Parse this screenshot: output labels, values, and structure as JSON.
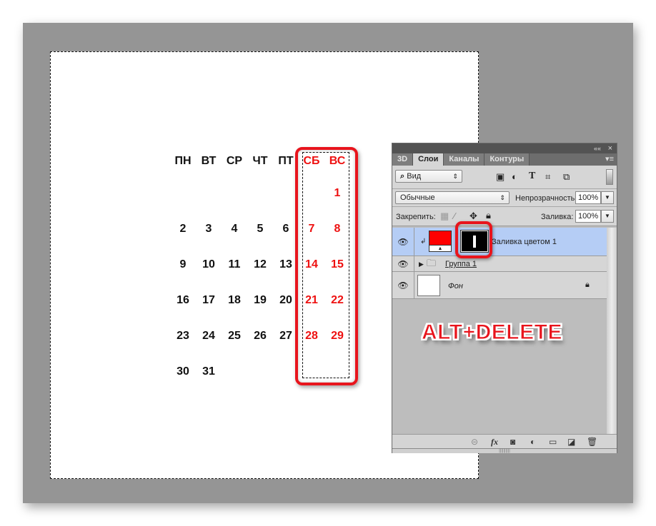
{
  "calendar": {
    "weekday_headers": [
      "ПН",
      "ВТ",
      "СР",
      "ЧТ",
      "ПТ",
      "СБ",
      "ВС"
    ],
    "weekend_color": "#ee1111",
    "weeks": [
      [
        "",
        "",
        "",
        "",
        "",
        "",
        "1"
      ],
      [
        "2",
        "3",
        "4",
        "5",
        "6",
        "7",
        "8"
      ],
      [
        "9",
        "10",
        "11",
        "12",
        "13",
        "14",
        "15"
      ],
      [
        "16",
        "17",
        "18",
        "19",
        "20",
        "21",
        "22"
      ],
      [
        "23",
        "24",
        "25",
        "26",
        "27",
        "28",
        "29"
      ],
      [
        "30",
        "31",
        "",
        "",
        "",
        "",
        ""
      ]
    ]
  },
  "panel": {
    "collapse_icon": "««",
    "close_icon": "×",
    "tabs": [
      {
        "label": "3D"
      },
      {
        "label": "Слои",
        "active": true
      },
      {
        "label": "Каналы"
      },
      {
        "label": "Контуры"
      }
    ],
    "menu_icon": "▾≡",
    "filter": {
      "search_icon": "⌕",
      "value": "Вид"
    },
    "filter_icons": [
      "image-icon",
      "adjustment-icon",
      "type-icon",
      "shape-icon",
      "smart-object-icon"
    ],
    "blend_mode": "Обычные",
    "opacity_label": "Непрозрачность:",
    "opacity_value": "100%",
    "lock_label": "Закрепить:",
    "fill_label": "Заливка:",
    "fill_value": "100%",
    "layers": [
      {
        "name": "Заливка цветом 1",
        "type": "fill",
        "color": "#ff0000",
        "selected": true
      },
      {
        "name": "Группа 1",
        "type": "group"
      },
      {
        "name": "Фон",
        "type": "background",
        "locked": true
      }
    ],
    "bottom_icons": [
      "link-icon",
      "fx-icon",
      "mask-icon",
      "adjustment-icon",
      "folder-icon",
      "new-layer-icon",
      "trash-icon"
    ]
  },
  "annotation": {
    "shortcut": "ALT+DELETE"
  }
}
